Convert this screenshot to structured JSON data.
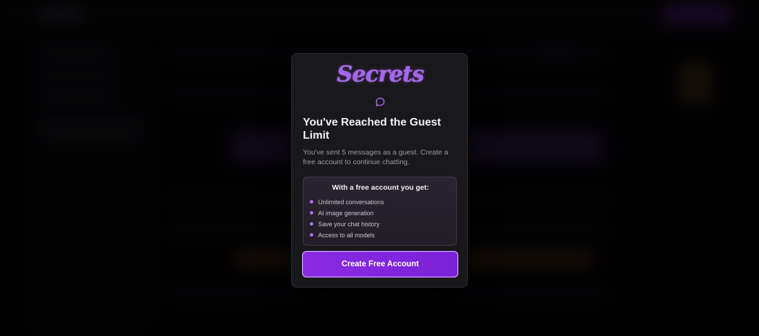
{
  "modal": {
    "brand": "Secrets",
    "icon": "chat-bubble-icon",
    "title": "You've Reached the Guest Limit",
    "subtitle": "You've sent 5 messages as a guest. Create a free account to continue chatting.",
    "benefits": {
      "heading": "With a free account you get:",
      "items": [
        "Unlimited conversations",
        "AI image generation",
        "Save your chat history",
        "Access to all models"
      ]
    },
    "cta_label": "Create Free Account"
  },
  "colors": {
    "accent": "#8a2be2",
    "brand": "#a566f0",
    "modal_bg": "#19181b",
    "bullet": "#b06cf4"
  }
}
